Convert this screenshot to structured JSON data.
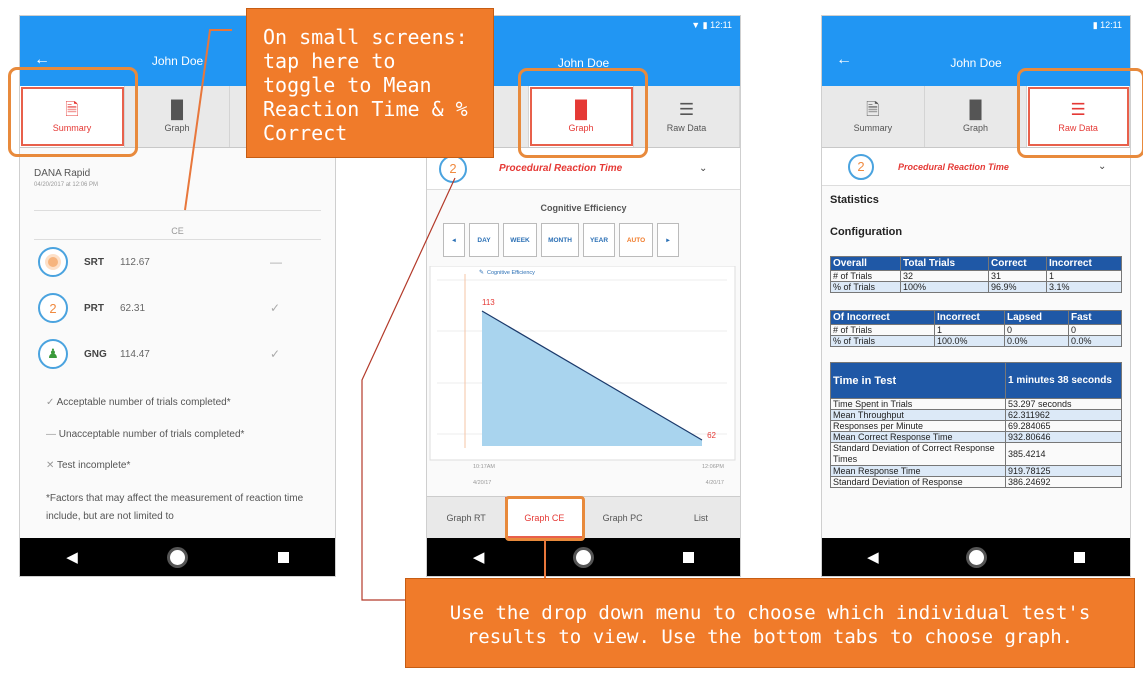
{
  "colors": {
    "appbar": "#2196f3",
    "accent": "#e53935",
    "callout": "#f07b2a",
    "table_header": "#1f58a6",
    "chart_fill": "#a9d4ee"
  },
  "left": {
    "title": "John Doe",
    "tabs": [
      {
        "label": "Summary",
        "icon": "document-icon"
      },
      {
        "label": "Graph",
        "icon": "bar-chart-icon"
      }
    ],
    "battery_name": "DANA Rapid",
    "battery_date": "04/20/2017 at 12:06 PM",
    "section": "CE",
    "tests": [
      {
        "icon": "srt-target-icon",
        "name": "SRT",
        "value": "112.67",
        "mark": "—"
      },
      {
        "icon": "prt-2-icon",
        "name": "PRT",
        "value": "62.31",
        "mark": "✓"
      },
      {
        "icon": "gng-icon",
        "name": "GNG",
        "value": "114.47",
        "mark": "✓"
      }
    ],
    "legend": [
      "Acceptable number of trials completed*",
      "Unacceptable number of trials completed*",
      "Test incomplete*"
    ],
    "note": "*Factors that may affect the measurement of reaction time include, but are not limited to"
  },
  "middle": {
    "status_time": "12:11",
    "title": "John Doe",
    "tabs": [
      {
        "label": "y",
        "icon": ""
      },
      {
        "label": "Graph",
        "icon": "bar-chart-icon"
      },
      {
        "label": "Raw Data",
        "icon": "list-icon"
      }
    ],
    "dropdown": "Procedural Reaction Time",
    "chart_title": "Cognitive Efficiency",
    "range_buttons": [
      "◂",
      "DAY",
      "WEEK",
      "MONTH",
      "YEAR",
      "AUTO",
      "▸"
    ],
    "bottom_tabs": [
      "Graph RT",
      "Graph CE",
      "Graph PC",
      "List"
    ]
  },
  "chart_data": {
    "type": "area",
    "title": "Cognitive Efficiency",
    "series": [
      {
        "name": "Cognitive Efficiency",
        "values": [
          113,
          62
        ]
      }
    ],
    "x": [
      "10:17AM 4/20/17",
      "12:06PM 4/20/17"
    ],
    "x_tick_labels": [
      [
        "10:17AM",
        "4/20/17"
      ],
      [
        "12:06PM",
        "4/20/17"
      ]
    ],
    "data_labels": [
      "113",
      "62"
    ]
  },
  "right": {
    "status_time": "12:11",
    "title": "John Doe",
    "tabs": [
      {
        "label": "Summary",
        "icon": "document-icon"
      },
      {
        "label": "Graph",
        "icon": "bar-chart-icon"
      },
      {
        "label": "Raw Data",
        "icon": "list-icon"
      }
    ],
    "dropdown": "Procedural Reaction Time",
    "statistics": "Statistics",
    "configuration": "Configuration",
    "overall": {
      "headers": [
        "Overall",
        "Total Trials",
        "Correct",
        "Incorrect"
      ],
      "rows": [
        [
          "# of Trials",
          "32",
          "31",
          "1"
        ],
        [
          "% of Trials",
          "100%",
          "96.9%",
          "3.1%"
        ]
      ]
    },
    "incorrect": {
      "headers": [
        "Of Incorrect",
        "Incorrect",
        "Lapsed",
        "Fast"
      ],
      "rows": [
        [
          "# of Trials",
          "1",
          "0",
          "0"
        ],
        [
          "% of Trials",
          "100.0%",
          "0.0%",
          "0.0%"
        ]
      ]
    },
    "time": {
      "header": "Time in Test",
      "value": "1 minutes 38 seconds",
      "rows": [
        [
          "Time Spent in Trials",
          "53.297 seconds"
        ],
        [
          "Mean Throughput",
          "62.311962"
        ],
        [
          "Responses per Minute",
          "69.284065"
        ],
        [
          "Mean Correct Response Time",
          "932.80646"
        ],
        [
          "Standard Deviation of Correct Response Times",
          "385.4214"
        ],
        [
          "Mean Response Time",
          "919.78125"
        ],
        [
          "Standard Deviation of Response",
          "386.24692"
        ]
      ]
    }
  },
  "callouts": {
    "top": "On small screens: tap here to toggle to Mean Reaction Time & % Correct",
    "bottom": "Use the drop down menu to choose which individual test's results to view. Use the bottom tabs to choose graph."
  }
}
